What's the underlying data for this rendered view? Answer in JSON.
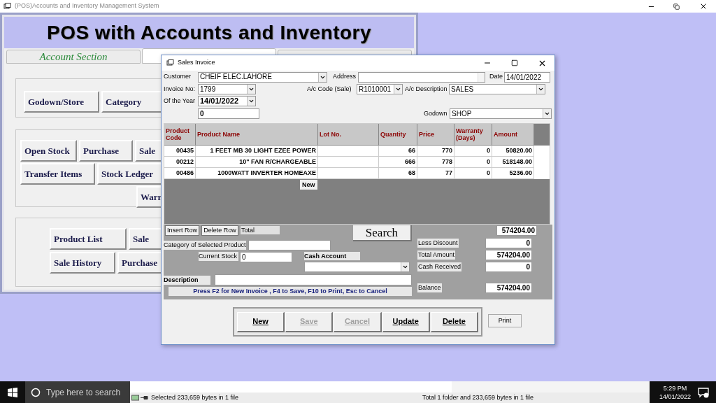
{
  "app_window": {
    "title": "(POS)Accounts  and Inventory Management System"
  },
  "main_form": {
    "banner": "POS with Accounts and Inventory",
    "section_tabs": [
      {
        "label": "Account Section",
        "selected": false
      },
      {
        "selected": true
      },
      {
        "selected": false
      }
    ],
    "button_groups": [
      {
        "buttons": [
          "Godown/Store",
          "Category"
        ]
      },
      {
        "buttons": [
          "Open Stock",
          "Purchase",
          "Sale",
          "Transfer Items",
          "Stock Ledger",
          "Warr"
        ]
      },
      {
        "buttons": [
          "Product List",
          "Sale",
          "Sale History",
          "Purchase"
        ]
      }
    ]
  },
  "invoice_window": {
    "title": "Sales Invoice",
    "customer": {
      "label": "Customer",
      "value": "CHEIF ELEC.LAHORE"
    },
    "address": {
      "label": "Address"
    },
    "date": {
      "label": "Date",
      "value": "14/01/2022"
    },
    "invoice_no": {
      "label": "Invoice No:",
      "value": "1799"
    },
    "ac_code": {
      "label": "A/c Code (Sale)",
      "value": "R1010001"
    },
    "ac_description": {
      "label": "A/c Description",
      "value": "SALES"
    },
    "year": {
      "label": "Of the Year",
      "value": "14/01/2022"
    },
    "number_field": {
      "value": "0"
    },
    "godown": {
      "label": "Godown",
      "value": "SHOP"
    },
    "table": {
      "columns": [
        "Product Code",
        "Product Name",
        "Lot No.",
        "Quantity",
        "Price",
        "Warranty (Days)",
        "Amount"
      ],
      "rows": [
        [
          "00435",
          "1 FEET MB 30 LIGHT EZEE POWER",
          "",
          "66",
          "770",
          "0",
          "50820.00"
        ],
        [
          "00212",
          "10\" FAN R/CHARGEABLE",
          "",
          "666",
          "778",
          "0",
          "518148.00"
        ],
        [
          "00486",
          "1000WATT INVERTER HOMEAXE",
          "",
          "68",
          "77",
          "0",
          "5236.00"
        ]
      ],
      "new_button": "New"
    },
    "insert_row": "Insert Row",
    "delete_row": "Delete Row",
    "total_label": "Total",
    "total_value": "574204.00",
    "search": "Search",
    "category": {
      "label": "Category of Selected Product"
    },
    "current_stock": {
      "label": "Current Stock",
      "value": "0"
    },
    "cash_account": {
      "label": "Cash Account"
    },
    "description": {
      "label": "Description"
    },
    "hint": "Press F2 for New Invoice , F4 to Save, F10 to Print, Esc to Cancel",
    "summary": [
      {
        "label": "Less Discount",
        "value": "0"
      },
      {
        "label": "Total Amount",
        "value": "574204.00"
      },
      {
        "label": "Cash Received",
        "value": "0"
      },
      {
        "label": "Balance",
        "value": "574204.00"
      }
    ],
    "actions": [
      {
        "label": "New",
        "disabled": false
      },
      {
        "label": "Save",
        "disabled": true
      },
      {
        "label": "Cancel",
        "disabled": true
      },
      {
        "label": "Update",
        "disabled": false
      },
      {
        "label": "Delete",
        "disabled": false
      }
    ],
    "print": "Print"
  },
  "taskbar": {
    "search_placeholder": "Type here to search",
    "status_left": "Selected 233,659 bytes in 1 file",
    "status_right": "Total 1 folder and 233,659 bytes in 1 file",
    "time": "5:29 PM",
    "date": "14/01/2022"
  }
}
